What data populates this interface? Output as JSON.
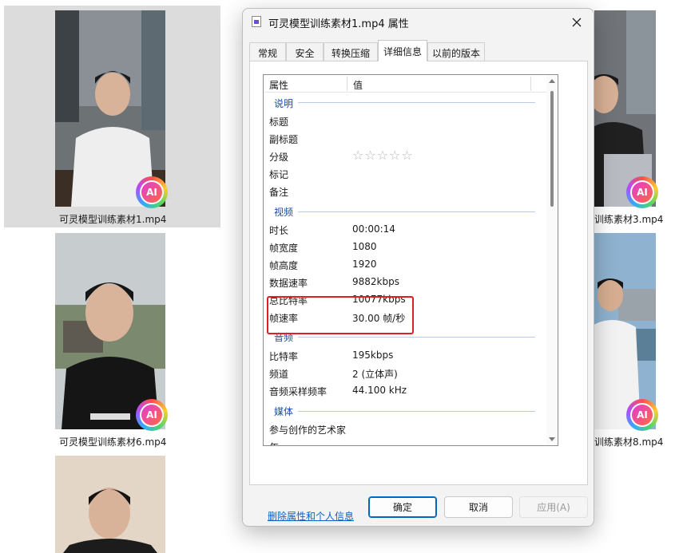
{
  "explorer": {
    "files": [
      {
        "caption": "可灵模型训练素材1.mp4",
        "badge": "AI"
      },
      {
        "caption": "训练素材3.mp4",
        "badge": "AI"
      },
      {
        "caption": "可灵模型训练素材6.mp4",
        "badge": "AI"
      },
      {
        "caption": "训练素材8.mp4",
        "badge": "AI"
      }
    ]
  },
  "dialog": {
    "title": "可灵模型训练素材1.mp4 属性",
    "close_icon": "close-icon",
    "tabs": [
      "常规",
      "安全",
      "转换压缩",
      "详细信息",
      "以前的版本"
    ],
    "active_tab": "详细信息",
    "columns": {
      "property": "属性",
      "value": "值"
    },
    "groups": {
      "description": {
        "label": "说明",
        "rows": [
          {
            "label": "标题",
            "value": ""
          },
          {
            "label": "副标题",
            "value": ""
          },
          {
            "label": "分级",
            "value": "☆☆☆☆☆"
          },
          {
            "label": "标记",
            "value": ""
          },
          {
            "label": "备注",
            "value": ""
          }
        ]
      },
      "video": {
        "label": "视频",
        "rows": [
          {
            "label": "时长",
            "value": "00:00:14"
          },
          {
            "label": "帧宽度",
            "value": "1080"
          },
          {
            "label": "帧高度",
            "value": "1920"
          },
          {
            "label": "数据速率",
            "value": "9882kbps"
          },
          {
            "label": "总比特率",
            "value": "10077kbps"
          },
          {
            "label": "帧速率",
            "value": "30.00 帧/秒"
          }
        ]
      },
      "audio": {
        "label": "音频",
        "rows": [
          {
            "label": "比特率",
            "value": "195kbps"
          },
          {
            "label": "频道",
            "value": "2 (立体声)"
          },
          {
            "label": "音频采样频率",
            "value": "44.100 kHz"
          }
        ]
      },
      "media": {
        "label": "媒体",
        "rows": [
          {
            "label": "参与创作的艺术家",
            "value": ""
          },
          {
            "label": "年",
            "value": ""
          }
        ]
      }
    },
    "delete_link": "删除属性和个人信息",
    "buttons": {
      "ok": "确定",
      "cancel": "取消",
      "apply": "应用(A)"
    },
    "colors": {
      "highlight": "#e02020",
      "link": "#0b62c4",
      "group": "#1a4ea3",
      "ok_border": "#0067c0"
    }
  }
}
